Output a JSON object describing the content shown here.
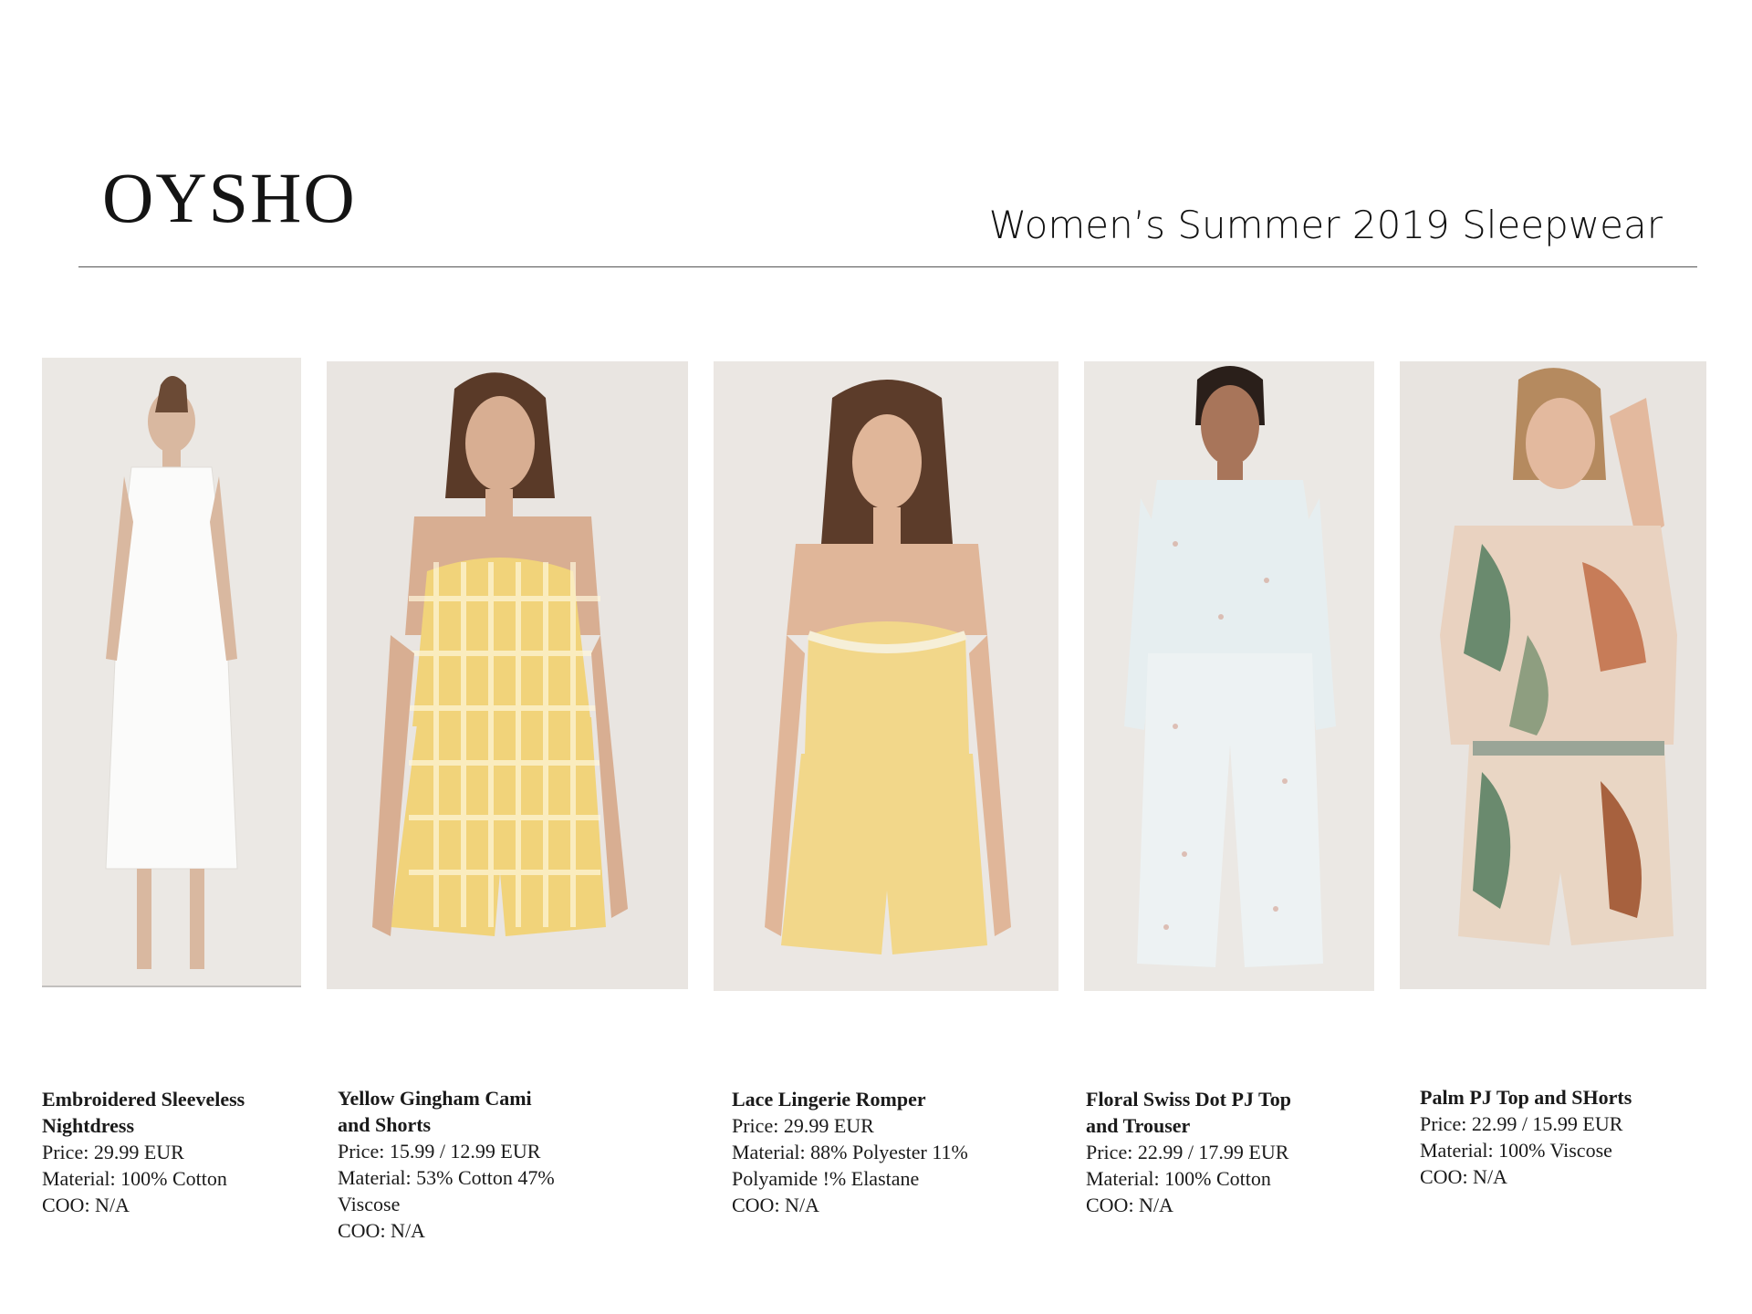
{
  "brand": {
    "logo_text": "OYSHO"
  },
  "page": {
    "title": "Women’s Summer 2019 Sleepwear"
  },
  "colors": {
    "rule": "#555555",
    "photo_bg": "#e8e4df"
  },
  "products": [
    {
      "name_l1": "Embroidered Sleeveless",
      "name_l2": "Nightdress",
      "price": "Price: 29.99 EUR",
      "material_l1": "Material: 100% Cotton",
      "material_l2": "",
      "coo": "COO: N/A"
    },
    {
      "name_l1": "Yellow Gingham Cami",
      "name_l2": "and Shorts",
      "price": "Price: 15.99 / 12.99 EUR",
      "material_l1": "Material: 53% Cotton 47%",
      "material_l2": "Viscose",
      "coo": "COO: N/A"
    },
    {
      "name_l1": "Lace Lingerie Romper",
      "name_l2": "",
      "price": "Price: 29.99 EUR",
      "material_l1": "Material: 88% Polyester 11%",
      "material_l2": "Polyamide !% Elastane",
      "coo": "COO: N/A"
    },
    {
      "name_l1": "Floral Swiss Dot PJ Top",
      "name_l2": "and Trouser",
      "price": "Price: 22.99 / 17.99 EUR",
      "material_l1": "Material: 100% Cotton",
      "material_l2": "",
      "coo": "COO: N/A"
    },
    {
      "name_l1": "Palm PJ Top and SHorts",
      "name_l2": "",
      "price": "Price: 22.99 / 15.99 EUR",
      "material_l1": "Material: 100% Viscose",
      "material_l2": "",
      "coo": "COO: N/A"
    }
  ]
}
